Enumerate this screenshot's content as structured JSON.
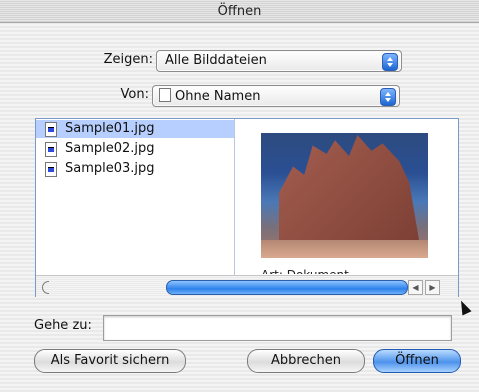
{
  "window": {
    "title": "Öffnen"
  },
  "show_popup": {
    "label": "Zeigen:",
    "value": "Alle Bilddateien"
  },
  "from_popup": {
    "label": "Von:",
    "value": "Ohne Namen"
  },
  "browser": {
    "files": [
      {
        "name": "Sample01.jpg",
        "selected": true
      },
      {
        "name": "Sample02.jpg",
        "selected": false
      },
      {
        "name": "Sample03.jpg",
        "selected": false
      }
    ],
    "preview": {
      "kind_label": "Art: Dokument"
    }
  },
  "goto": {
    "label": "Gehe zu:",
    "value": ""
  },
  "buttons": {
    "favorite": "Als Favorit sichern",
    "cancel": "Abbrechen",
    "open": "Öffnen"
  },
  "icons": [
    "document-icon",
    "image-file-icon",
    "popup-arrows-icon",
    "mouse-pointer-icon"
  ],
  "colors": {
    "selection": "#b7cfff",
    "accent_blue": "#2e82ec"
  }
}
